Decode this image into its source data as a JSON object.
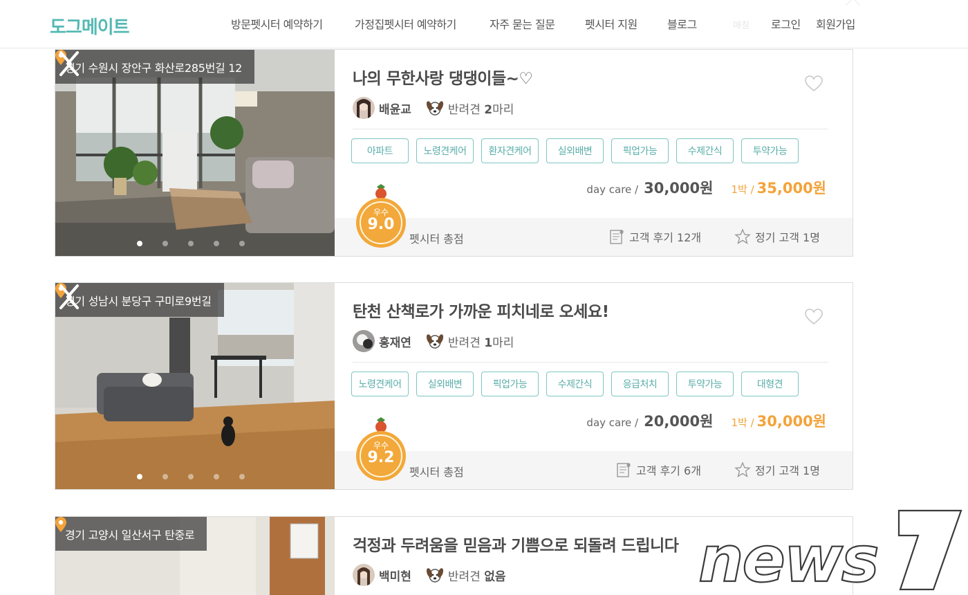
{
  "header": {
    "logo": "도그메이트",
    "nav": [
      "방문펫시터 예약하기",
      "가정집펫시터 예약하기",
      "자주 묻는 질문",
      "펫시터 지원",
      "블로그"
    ],
    "faint": "매칭",
    "login": "로그인",
    "signup": "회원가입"
  },
  "listings": [
    {
      "location": "경기 수원시 장안구 화산로285번길 12",
      "title": "나의 무한사랑 댕댕이들~♡",
      "host": "배윤교",
      "pets_prefix": "반려견 ",
      "pets_count": "2",
      "pets_suffix": "마리",
      "tags": [
        "아파트",
        "노령견케어",
        "환자견케어",
        "실외배변",
        "픽업가능",
        "수제간식",
        "투약가능"
      ],
      "daycare_label": "day care /",
      "daycare_price": "30,000원",
      "night_label": "1박 /",
      "night_price": "35,000원",
      "grade": "우수",
      "score": "9.0",
      "score_label": "펫시터 총점",
      "reviews": "고객 후기 12개",
      "regulars": "정기 고객 1명"
    },
    {
      "location": "경기 성남시 분당구 구미로9번길",
      "title": "탄천 산책로가 가까운 피치네로 오세요!",
      "host": "홍재연",
      "pets_prefix": "반려견 ",
      "pets_count": "1",
      "pets_suffix": "마리",
      "tags": [
        "노령견케어",
        "실외배변",
        "픽업가능",
        "수제간식",
        "응급처치",
        "투약가능",
        "대형견"
      ],
      "daycare_label": "day care /",
      "daycare_price": "20,000원",
      "night_label": "1박 /",
      "night_price": "30,000원",
      "grade": "우수",
      "score": "9.2",
      "score_label": "펫시터 총점",
      "reviews": "고객 후기 6개",
      "regulars": "정기 고객 1명"
    },
    {
      "location": "경기 고양시 일산서구 탄중로",
      "title": "걱정과 두려움을 믿음과 기쁨으로 되돌려 드립니다",
      "host": "백미현",
      "pets_prefix": "반려견 ",
      "pets_count": "없음",
      "pets_suffix": ""
    }
  ],
  "watermark": "news1",
  "colors": {
    "brand": "#54b9b3",
    "tag_border": "#7cc6c1",
    "night_price": "#f3a33a",
    "medal": "#f2a83a"
  }
}
